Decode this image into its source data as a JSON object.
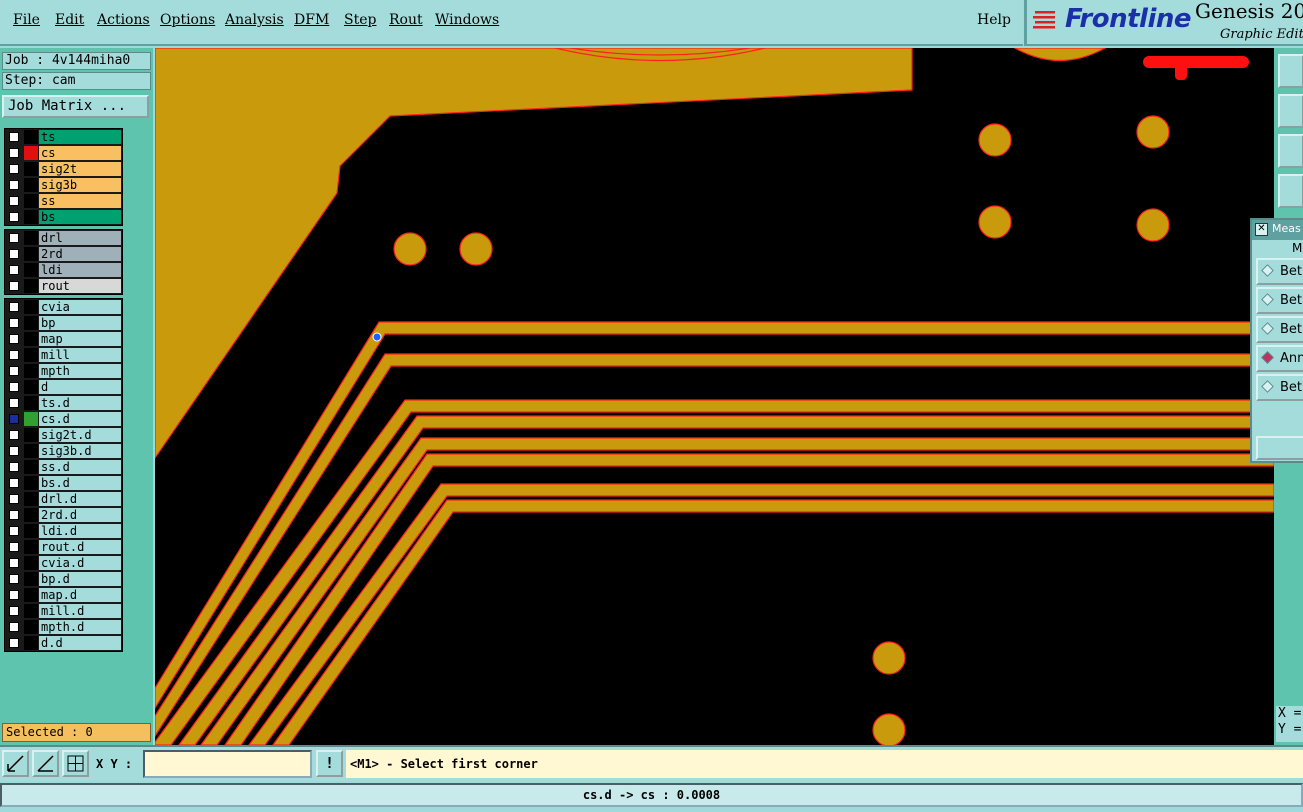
{
  "menu": {
    "items": [
      "File",
      "Edit",
      "Actions",
      "Options",
      "Analysis",
      "DFM",
      "Step",
      "Rout",
      "Windows"
    ],
    "help": "Help"
  },
  "brand": {
    "logo": "Frontline",
    "product": "Genesis 20",
    "subtitle": "Graphic Editor"
  },
  "job": {
    "job_line": "Job : 4v144miha0",
    "step_line": "Step: cam",
    "matrix_button": "Job Matrix ..."
  },
  "layers": {
    "board": [
      {
        "name": "ts",
        "color": "#00a070",
        "swatch": "#000000"
      },
      {
        "name": "cs",
        "color": "#f8c060",
        "swatch": "#e01010"
      },
      {
        "name": "sig2t",
        "color": "#f8c060",
        "swatch": "#000000"
      },
      {
        "name": "sig3b",
        "color": "#f8c060",
        "swatch": "#000000"
      },
      {
        "name": "ss",
        "color": "#f8c060",
        "swatch": "#000000"
      },
      {
        "name": "bs",
        "color": "#00a070",
        "swatch": "#000000"
      }
    ],
    "drill": [
      {
        "name": "drl",
        "color": "#a0b0b8",
        "swatch": "#000000"
      },
      {
        "name": "2rd",
        "color": "#a0b0b8",
        "swatch": "#000000"
      },
      {
        "name": "ldi",
        "color": "#a0b0b8",
        "swatch": "#000000"
      },
      {
        "name": "rout",
        "color": "#d8d8d8",
        "swatch": "#000000"
      }
    ],
    "misc": [
      {
        "name": "cvia",
        "color": "#a4dcdc",
        "swatch": "#000000"
      },
      {
        "name": "bp",
        "color": "#a4dcdc",
        "swatch": "#000000"
      },
      {
        "name": "map",
        "color": "#a4dcdc",
        "swatch": "#000000"
      },
      {
        "name": "mill",
        "color": "#a4dcdc",
        "swatch": "#000000"
      },
      {
        "name": "mpth",
        "color": "#a4dcdc",
        "swatch": "#000000"
      },
      {
        "name": "d",
        "color": "#a4dcdc",
        "swatch": "#000000"
      },
      {
        "name": "ts.d",
        "color": "#a4dcdc",
        "swatch": "#000000"
      },
      {
        "name": "cs.d",
        "color": "#a4dcdc",
        "swatch": "#30a030",
        "selected": true
      },
      {
        "name": "sig2t.d",
        "color": "#a4dcdc",
        "swatch": "#000000"
      },
      {
        "name": "sig3b.d",
        "color": "#a4dcdc",
        "swatch": "#000000"
      },
      {
        "name": "ss.d",
        "color": "#a4dcdc",
        "swatch": "#000000"
      },
      {
        "name": "bs.d",
        "color": "#a4dcdc",
        "swatch": "#000000"
      },
      {
        "name": "drl.d",
        "color": "#a4dcdc",
        "swatch": "#000000"
      },
      {
        "name": "2rd.d",
        "color": "#a4dcdc",
        "swatch": "#000000"
      },
      {
        "name": "ldi.d",
        "color": "#a4dcdc",
        "swatch": "#000000"
      },
      {
        "name": "rout.d",
        "color": "#a4dcdc",
        "swatch": "#000000"
      },
      {
        "name": "cvia.d",
        "color": "#a4dcdc",
        "swatch": "#000000"
      },
      {
        "name": "bp.d",
        "color": "#a4dcdc",
        "swatch": "#000000"
      },
      {
        "name": "map.d",
        "color": "#a4dcdc",
        "swatch": "#000000"
      },
      {
        "name": "mill.d",
        "color": "#a4dcdc",
        "swatch": "#000000"
      },
      {
        "name": "mpth.d",
        "color": "#a4dcdc",
        "swatch": "#000000"
      },
      {
        "name": "d.d",
        "color": "#a4dcdc",
        "swatch": "#000000"
      }
    ]
  },
  "selection": {
    "text": "Selected : 0"
  },
  "measure": {
    "title": "Meas",
    "header": "Me",
    "options": [
      {
        "label": "Bet",
        "active": false
      },
      {
        "label": "Bet",
        "active": false
      },
      {
        "label": "Bet",
        "active": false
      },
      {
        "label": "Ann",
        "active": true
      },
      {
        "label": "Bet",
        "active": false
      }
    ]
  },
  "coords": {
    "x_label": "X =",
    "y_label": "Y ="
  },
  "bottom": {
    "xy_label": "X Y :",
    "xy_value": "",
    "prompt_icon": "!",
    "prompt": "<M1> - Select first corner"
  },
  "status": {
    "text": "cs.d -> cs : 0.0008"
  },
  "colors": {
    "copper": "#c99a0b",
    "outline": "#ff2020",
    "canvas": "#000000",
    "accent": "#1b2fa8"
  }
}
